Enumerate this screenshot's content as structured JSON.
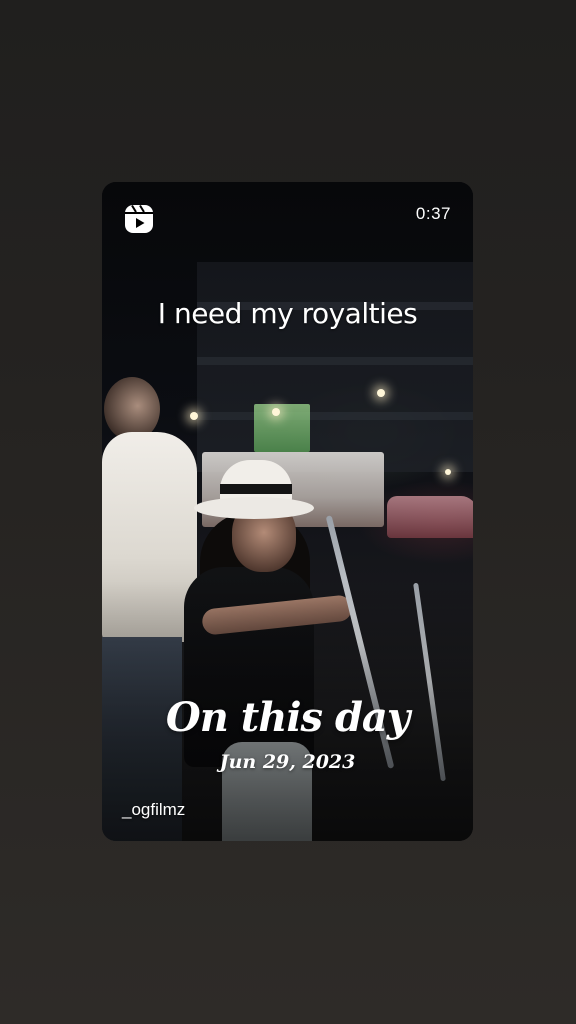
{
  "story": {
    "duration": "0:37",
    "caption": "I need my royalties",
    "memory_title": "On this day",
    "memory_date": "Jun 29, 2023",
    "username": "_ogfilmz",
    "icon": "reels-icon"
  },
  "colors": {
    "background": "#252321",
    "text": "#ffffff"
  }
}
